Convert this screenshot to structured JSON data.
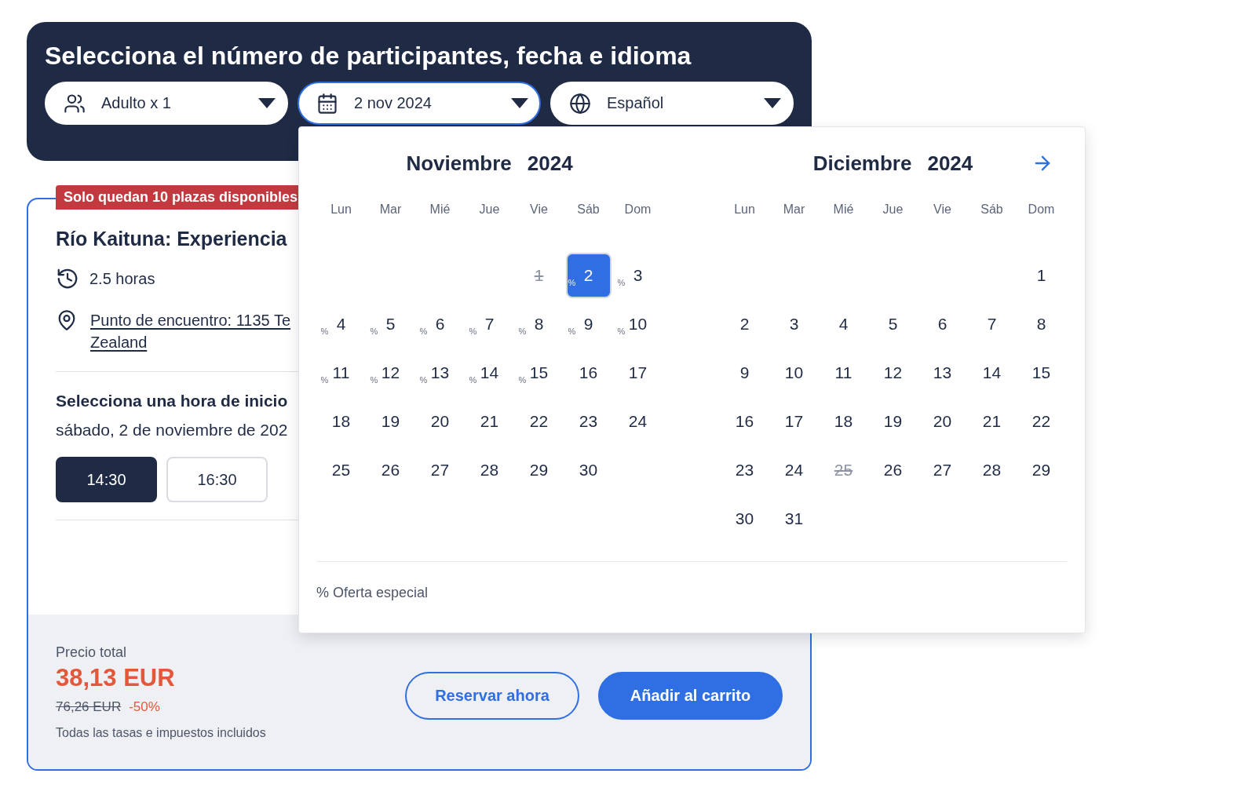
{
  "booking_header": {
    "title": "Selecciona el número de participantes, fecha e idioma",
    "selectors": [
      {
        "kind": "participants",
        "value": "Adulto x 1",
        "open": false
      },
      {
        "kind": "date",
        "value": "2 nov 2024",
        "open": true
      },
      {
        "kind": "language",
        "value": "Español",
        "open": false
      }
    ]
  },
  "activity_card": {
    "availability_badge": "Solo quedan 10 plazas disponibles",
    "title": "Río Kaituna: Experiencia",
    "duration": "2.5 horas",
    "meeting_point_lines": [
      "Punto de encuentro: 1135 Te",
      "Zealand"
    ],
    "start_time": {
      "heading": "Selecciona una hora de inicio",
      "date": "sábado, 2 de noviembre de 202",
      "times": [
        {
          "label": "14:30",
          "selected": true
        },
        {
          "label": "16:30",
          "selected": false
        }
      ]
    },
    "price": {
      "label": "Precio total",
      "amount": "38,13 EUR",
      "original": "76,26 EUR",
      "discount": "-50%",
      "note": "Todas las tasas e impuestos incluidos"
    },
    "actions": [
      {
        "kind": "secondary",
        "label": "Reservar ahora"
      },
      {
        "kind": "primary",
        "label": "Añadir al carrito"
      }
    ]
  },
  "date_picker": {
    "months": [
      {
        "month": "Noviembre",
        "year": "2024",
        "weekdays": [
          "Lun",
          "Mar",
          "Mié",
          "Jue",
          "Vie",
          "Sáb",
          "Dom"
        ],
        "weeks": [
          {
            "right_aligned": true,
            "days": [
              {
                "day": "1",
                "selected": false,
                "disabled": true
              },
              {
                "day": "2",
                "mark": "%",
                "selected": true,
                "disabled": false
              },
              {
                "day": "3",
                "mark": "%",
                "selected": false,
                "disabled": false
              }
            ]
          },
          {
            "days": [
              {
                "day": "4",
                "mark": "%",
                "selected": false,
                "disabled": false
              },
              {
                "day": "5",
                "mark": "%",
                "selected": false,
                "disabled": false
              },
              {
                "day": "6",
                "mark": "%",
                "selected": false,
                "disabled": false
              },
              {
                "day": "7",
                "mark": "%",
                "selected": false,
                "disabled": false
              },
              {
                "day": "8",
                "mark": "%",
                "selected": false,
                "disabled": false
              },
              {
                "day": "9",
                "mark": "%",
                "selected": false,
                "disabled": false
              },
              {
                "day": "10",
                "mark": "%",
                "selected": false,
                "disabled": false
              }
            ]
          },
          {
            "days": [
              {
                "day": "11",
                "mark": "%",
                "selected": false,
                "disabled": false
              },
              {
                "day": "12",
                "mark": "%",
                "selected": false,
                "disabled": false
              },
              {
                "day": "13",
                "mark": "%",
                "selected": false,
                "disabled": false
              },
              {
                "day": "14",
                "mark": "%",
                "selected": false,
                "disabled": false
              },
              {
                "day": "15",
                "mark": "%",
                "selected": false,
                "disabled": false
              },
              {
                "day": "16",
                "selected": false,
                "disabled": false
              },
              {
                "day": "17",
                "selected": false,
                "disabled": false
              }
            ]
          },
          {
            "days": [
              {
                "day": "18",
                "selected": false,
                "disabled": false
              },
              {
                "day": "19",
                "selected": false,
                "disabled": false
              },
              {
                "day": "20",
                "selected": false,
                "disabled": false
              },
              {
                "day": "21",
                "selected": false,
                "disabled": false
              },
              {
                "day": "22",
                "selected": false,
                "disabled": false
              },
              {
                "day": "23",
                "selected": false,
                "disabled": false
              },
              {
                "day": "24",
                "selected": false,
                "disabled": false
              }
            ]
          },
          {
            "right_aligned": false,
            "days": [
              {
                "day": "25",
                "selected": false,
                "disabled": false
              },
              {
                "day": "26",
                "selected": false,
                "disabled": false
              },
              {
                "day": "27",
                "selected": false,
                "disabled": false
              },
              {
                "day": "28",
                "selected": false,
                "disabled": false
              },
              {
                "day": "29",
                "selected": false,
                "disabled": false
              },
              {
                "day": "30",
                "selected": false,
                "disabled": false
              }
            ]
          }
        ]
      },
      {
        "month": "Diciembre",
        "year": "2024",
        "weekdays": [
          "Lun",
          "Mar",
          "Mié",
          "Jue",
          "Vie",
          "Sáb",
          "Dom"
        ],
        "weeks": [
          {
            "right_aligned": true,
            "days": [
              {
                "day": "1",
                "selected": false,
                "disabled": false
              }
            ]
          },
          {
            "days": [
              {
                "day": "2",
                "selected": false,
                "disabled": false
              },
              {
                "day": "3",
                "selected": false,
                "disabled": false
              },
              {
                "day": "4",
                "selected": false,
                "disabled": false
              },
              {
                "day": "5",
                "selected": false,
                "disabled": false
              },
              {
                "day": "6",
                "selected": false,
                "disabled": false
              },
              {
                "day": "7",
                "selected": false,
                "disabled": false
              },
              {
                "day": "8",
                "selected": false,
                "disabled": false
              }
            ]
          },
          {
            "days": [
              {
                "day": "9",
                "selected": false,
                "disabled": false
              },
              {
                "day": "10",
                "selected": false,
                "disabled": false
              },
              {
                "day": "11",
                "selected": false,
                "disabled": false
              },
              {
                "day": "12",
                "selected": false,
                "disabled": false
              },
              {
                "day": "13",
                "selected": false,
                "disabled": false
              },
              {
                "day": "14",
                "selected": false,
                "disabled": false
              },
              {
                "day": "15",
                "selected": false,
                "disabled": false
              }
            ]
          },
          {
            "days": [
              {
                "day": "16",
                "selected": false,
                "disabled": false
              },
              {
                "day": "17",
                "selected": false,
                "disabled": false
              },
              {
                "day": "18",
                "selected": false,
                "disabled": false
              },
              {
                "day": "19",
                "selected": false,
                "disabled": false
              },
              {
                "day": "20",
                "selected": false,
                "disabled": false
              },
              {
                "day": "21",
                "selected": false,
                "disabled": false
              },
              {
                "day": "22",
                "selected": false,
                "disabled": false
              }
            ]
          },
          {
            "days": [
              {
                "day": "23",
                "selected": false,
                "disabled": false
              },
              {
                "day": "24",
                "selected": false,
                "disabled": false
              },
              {
                "day": "25",
                "selected": false,
                "disabled": true
              },
              {
                "day": "26",
                "selected": false,
                "disabled": false
              },
              {
                "day": "27",
                "selected": false,
                "disabled": false
              },
              {
                "day": "28",
                "selected": false,
                "disabled": false
              },
              {
                "day": "29",
                "selected": false,
                "disabled": false
              }
            ]
          },
          {
            "right_aligned": false,
            "days": [
              {
                "day": "30",
                "selected": false,
                "disabled": false
              },
              {
                "day": "31",
                "selected": false,
                "disabled": false
              }
            ]
          }
        ]
      }
    ],
    "legend": "% Oferta especial"
  }
}
